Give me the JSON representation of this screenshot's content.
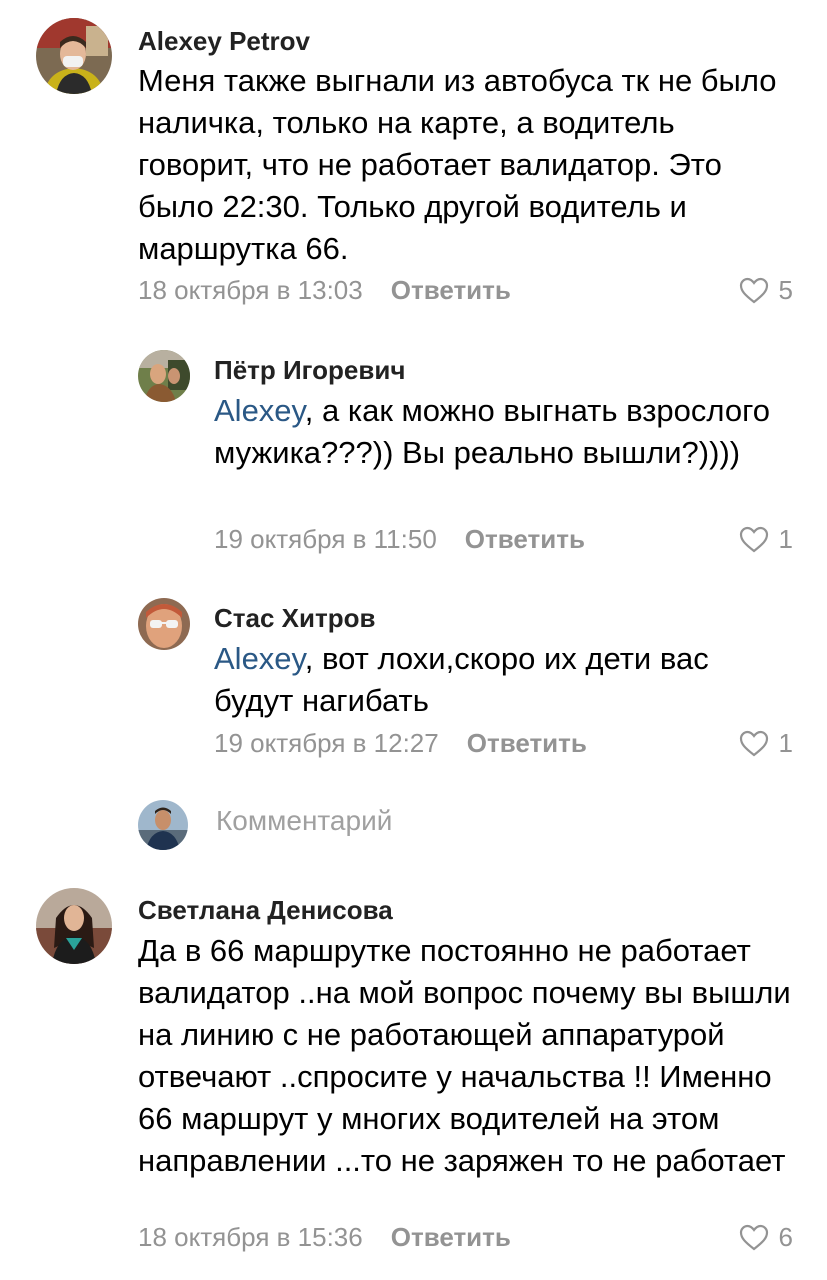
{
  "comments": [
    {
      "author": "Alexey Petrov",
      "mention": "",
      "text": "Меня также выгнали из автобуса тк не было наличка, только на карте, а водитель говорит, что не работает валидатор. Это было 22:30. Только другой водитель и маршрутка 66.",
      "date": "18 октября в 13:03",
      "reply_label": "Ответить",
      "likes": "5"
    },
    {
      "author": "Пётр Игоревич",
      "mention": "Alexey",
      "text": ", а как можно выгнать взрослого мужика???)) Вы реально вышли?))))",
      "date": "19 октября в 11:50",
      "reply_label": "Ответить",
      "likes": "1"
    },
    {
      "author": "Стас Хитров",
      "mention": "Alexey",
      "text": ", вот лохи,скоро их дети вас будут нагибать",
      "date": "19 октября в 12:27",
      "reply_label": "Ответить",
      "likes": "1"
    },
    {
      "author": "Светлана Денисова",
      "mention": "",
      "text": "Да в 66 маршрутке постоянно не работает валидатор ..на мой вопрос почему вы вышли на линию с не работающей аппаратурой отвечают ..спросите у начальства !! Именно 66 маршрут у многих водителей на этом направлении ...то не заряжен то не работает",
      "date": "18 октября в 15:36",
      "reply_label": "Ответить",
      "likes": "6"
    }
  ],
  "reply_input": {
    "placeholder": "Комментарий"
  },
  "colors": {
    "mention": "#2a5885",
    "meta": "#939393",
    "author": "#222222"
  },
  "icons": {
    "like": "heart-outline-icon"
  }
}
